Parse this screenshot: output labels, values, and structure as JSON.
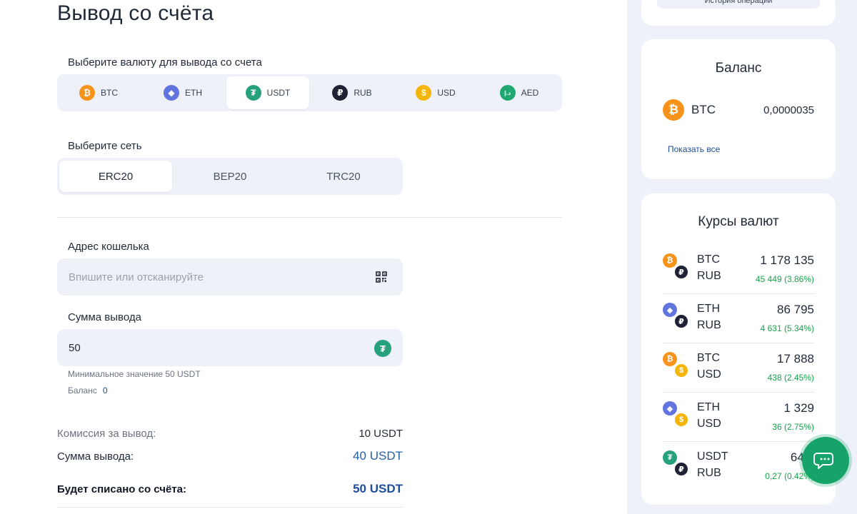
{
  "page": {
    "title": "Вывод со счёта"
  },
  "currency_select": {
    "label": "Выберите валюту для вывода со счета",
    "options": [
      {
        "code": "BTC",
        "icon": "bitcoin-icon",
        "glyph": "₿"
      },
      {
        "code": "ETH",
        "icon": "ethereum-icon",
        "glyph": "◆"
      },
      {
        "code": "USDT",
        "icon": "tether-icon",
        "glyph": "₮"
      },
      {
        "code": "RUB",
        "icon": "ruble-icon",
        "glyph": "₽"
      },
      {
        "code": "USD",
        "icon": "dollar-icon",
        "glyph": "$"
      },
      {
        "code": "AED",
        "icon": "dirham-icon",
        "glyph": "د.إ"
      }
    ],
    "selected": "USDT"
  },
  "network_select": {
    "label": "Выберите сеть",
    "options": [
      "ERC20",
      "BEP20",
      "TRC20"
    ],
    "selected": "ERC20"
  },
  "wallet": {
    "label": "Адрес кошелька",
    "placeholder": "Впишите или отсканируйте",
    "value": ""
  },
  "amount": {
    "label": "Сумма вывода",
    "value": "50",
    "min_hint": "Минимальное значение 50 USDT",
    "balance_label": "Баланс",
    "balance_value": "0"
  },
  "summary": {
    "fee_label": "Комиссия за вывод:",
    "fee_value": "10 USDT",
    "amount_label": "Сумма вывода:",
    "amount_value": "40 USDT",
    "total_label": "Будет списано со счёта:",
    "total_value": "50 USDT"
  },
  "sidebar": {
    "history_button": "История операций",
    "balance_card": {
      "title": "Баланс",
      "currency": "BTC",
      "amount": "0,0000035",
      "show_all": "Показать все"
    },
    "rates_card": {
      "title": "Курсы валют",
      "rows": [
        {
          "base": "BTC",
          "quote": "RUB",
          "value": "1 178 135",
          "change": "45 449 (3.86%)"
        },
        {
          "base": "ETH",
          "quote": "RUB",
          "value": "86 795",
          "change": "4 631 (5.34%)"
        },
        {
          "base": "BTC",
          "quote": "USD",
          "value": "17 888",
          "change": "438 (2.45%)"
        },
        {
          "base": "ETH",
          "quote": "USD",
          "value": "1 329",
          "change": "36 (2.75%)"
        },
        {
          "base": "USDT",
          "quote": "RUB",
          "value": "64,9",
          "change": "0,27 (0.42%)"
        }
      ]
    }
  },
  "colors": {
    "accent": "#1f4f8f",
    "positive": "#16a34a",
    "chat": "#15a36a"
  }
}
